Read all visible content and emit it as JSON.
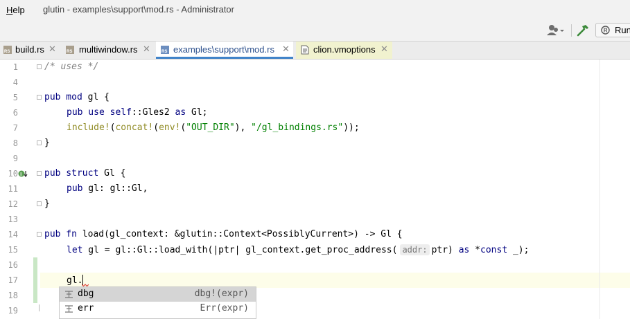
{
  "menu": {
    "help_mnemonic": "H",
    "help_rest": "elp"
  },
  "window": {
    "title": "glutin - examples\\support\\mod.rs - Administrator"
  },
  "toolbar": {
    "run_label": "Run"
  },
  "tabs": [
    {
      "label": "build.rs",
      "icon": "rust-file-icon",
      "closable": true
    },
    {
      "label": "multiwindow.rs",
      "icon": "rust-file-icon",
      "closable": true
    },
    {
      "label": "examples\\support\\mod.rs",
      "icon": "rust-file-icon",
      "closable": true,
      "active": true
    },
    {
      "label": "clion.vmoptions",
      "icon": "text-file-icon",
      "closable": true
    }
  ],
  "editor": {
    "lines": [
      {
        "n": "1"
      },
      {
        "n": "4"
      },
      {
        "n": "5"
      },
      {
        "n": "6"
      },
      {
        "n": "7"
      },
      {
        "n": "8"
      },
      {
        "n": "9"
      },
      {
        "n": "10"
      },
      {
        "n": "11"
      },
      {
        "n": "12"
      },
      {
        "n": "13"
      },
      {
        "n": "14"
      },
      {
        "n": "15"
      },
      {
        "n": "16"
      },
      {
        "n": "17"
      },
      {
        "n": "18"
      },
      {
        "n": "19"
      }
    ],
    "code": {
      "l1": "/* uses */",
      "l5": {
        "kw": "pub mod",
        "rest": " gl {"
      },
      "l6": {
        "kw1": "pub use self",
        "mid": "::Gles2 ",
        "kw2": "as",
        "rest": " Gl;"
      },
      "l7": {
        "mac1": "include!",
        "p1": "(",
        "mac2": "concat!",
        "p2": "(",
        "mac3": "env!",
        "p3": "(",
        "s1": "\"OUT_DIR\"",
        "p4": "), ",
        "s2": "\"/gl_bindings.rs\"",
        "p5": "));"
      },
      "l8": "}",
      "l10": {
        "kw": "pub struct",
        "rest": " Gl {"
      },
      "l11": {
        "kw": "pub",
        "rest": " gl: gl::Gl,"
      },
      "l12": "}",
      "l14": {
        "kw": "pub fn",
        "rest": " load(gl_context: &glutin::Context<PossiblyCurrent>) -> Gl {"
      },
      "l15": {
        "kw": "let",
        "mid": " gl = gl::Gl::load_with(|ptr| gl_context.get_proc_address(",
        "hint": "addr:",
        "after": "ptr) ",
        "kw2": "as",
        "ptr": " *",
        "kw3": "const",
        "end": " _);"
      },
      "l17": "gl."
    }
  },
  "completion": {
    "items": [
      {
        "name": "dbg",
        "type": "dbg!(expr)",
        "selected": true
      },
      {
        "name": "err",
        "type": "Err(expr)",
        "selected": false
      }
    ]
  }
}
